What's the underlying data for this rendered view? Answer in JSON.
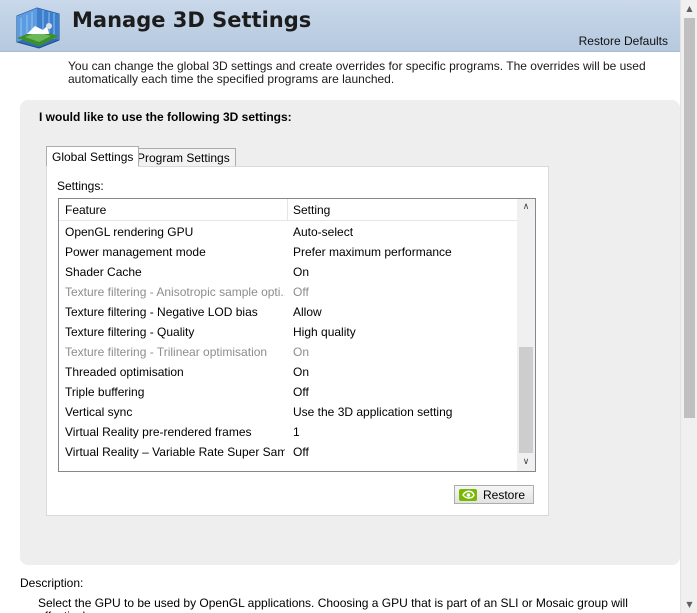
{
  "header": {
    "title": "Manage 3D Settings",
    "restore_defaults": "Restore Defaults"
  },
  "intro": "You can change the global 3D settings and create overrides for specific programs. The overrides will be used automatically each time the specified programs are launched.",
  "panel": {
    "heading": "I would like to use the following 3D settings:",
    "tabs": [
      {
        "label": "Global Settings",
        "active": true
      },
      {
        "label": "Program Settings",
        "active": false
      }
    ],
    "settings_label": "Settings:",
    "columns": {
      "feature": "Feature",
      "setting": "Setting"
    },
    "rows": [
      {
        "feature": "OpenGL rendering GPU",
        "setting": "Auto-select",
        "disabled": false
      },
      {
        "feature": "Power management mode",
        "setting": "Prefer maximum performance",
        "disabled": false
      },
      {
        "feature": "Shader Cache",
        "setting": "On",
        "disabled": false
      },
      {
        "feature": "Texture filtering - Anisotropic sample opti...",
        "setting": "Off",
        "disabled": true
      },
      {
        "feature": "Texture filtering - Negative LOD bias",
        "setting": "Allow",
        "disabled": false
      },
      {
        "feature": "Texture filtering - Quality",
        "setting": "High quality",
        "disabled": false
      },
      {
        "feature": "Texture filtering - Trilinear optimisation",
        "setting": "On",
        "disabled": true
      },
      {
        "feature": "Threaded optimisation",
        "setting": "On",
        "disabled": false
      },
      {
        "feature": "Triple buffering",
        "setting": "Off",
        "disabled": false
      },
      {
        "feature": "Vertical sync",
        "setting": "Use the 3D application setting",
        "disabled": false
      },
      {
        "feature": "Virtual Reality pre-rendered frames",
        "setting": "1",
        "disabled": false
      },
      {
        "feature": "Virtual Reality – Variable Rate Super Samp...",
        "setting": "Off",
        "disabled": false
      }
    ],
    "restore_button": "Restore"
  },
  "description": {
    "label": "Description:",
    "text": "Select the GPU to be used by OpenGL applications. Choosing a GPU that is part of an SLI or Mosaic group will effectively"
  },
  "icons": {
    "app": "nvidia-3d-settings-icon",
    "restore": "nvidia-logo-icon"
  },
  "colors": {
    "header_bg": "#c9d8ea",
    "nvidia_green": "#76b900",
    "disabled_text": "#8d8d8d"
  }
}
